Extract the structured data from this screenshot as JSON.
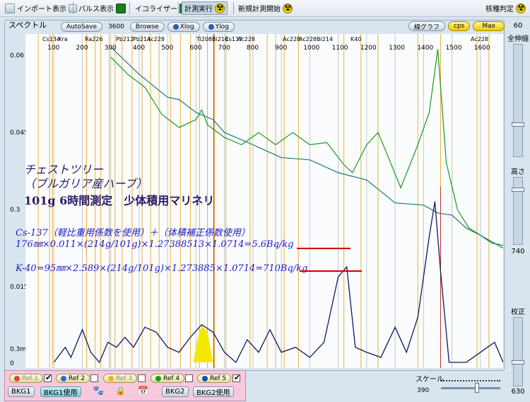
{
  "toolbar": {
    "import_label": "インポート表示",
    "pulse_label": "パルス表示",
    "equalizer_label": "イコライザー",
    "run_label": "計測実行",
    "new_label": "新規計測開始",
    "nuclide_label": "核種判定"
  },
  "spectrum": {
    "panel_title": "スペクトル",
    "autosave_label": "AutoSave",
    "autosave_value": "3600",
    "browse_label": "Browse",
    "xlog_label": "Xlog",
    "ylog_label": "Ylog",
    "line_graph_label": "線グラフ",
    "cps_label": "cps",
    "max_label": "Max"
  },
  "right_panel": {
    "value_top": "60",
    "full_stretch_label": "全伸縮",
    "height_label": "高さ",
    "height_value": "740",
    "correction_label": "校正",
    "correction_value": "630"
  },
  "nuclides": [
    "Cs134",
    "Xra",
    "Ra226",
    "Pb212",
    "Pb214",
    "Ac228",
    "Ti208",
    "Bi214",
    "Cs137",
    "Ac228",
    "Ac228",
    "Ac228",
    "Bi214",
    "K40",
    "Ac228"
  ],
  "annotation": {
    "title_line1": "チェストツリー",
    "title_line2": "（ブルガリア産ハーブ）",
    "title_line3": "101g 6時間測定　少体積用マリネリ",
    "cs_header": "Cs-137（軽比重用係数を使用）＋（体積補正係数使用）",
    "cs_formula": "176㎜×0.011×(214g/101g)×1.27388513×1.0714=5.6Bq/kg",
    "k_formula": "K-40=95㎜×2.589×(214g/101g)×1.273885×1.0714=710Bq/kg"
  },
  "bottom": {
    "refs": [
      {
        "label": "Ref 1",
        "checked": true
      },
      {
        "label": "Ref 2",
        "checked": false
      },
      {
        "label": "Ref 3",
        "checked": false
      },
      {
        "label": "Ref 4",
        "checked": false
      },
      {
        "label": "Ref 5",
        "checked": true
      }
    ],
    "bkg1_label": "BKG1",
    "bkg1_use_label": "BKG1使用",
    "bkg2_label": "BKG2",
    "bkg2_use_label": "BKG2使用",
    "scale_label": "スケール",
    "scale_value": "390"
  },
  "chart_data": {
    "type": "line",
    "x_ticks": [
      "100",
      "200",
      "300",
      "400",
      "500",
      "600",
      "700",
      "800",
      "900",
      "1000",
      "1100",
      "1200",
      "1300",
      "1400",
      "1500",
      "1600"
    ],
    "y_ticks": [
      "0.06",
      "0.045",
      "0.3",
      "0.015",
      "0.3m",
      "0"
    ],
    "xlim": [
      0,
      1680
    ],
    "series": [
      {
        "name": "",
        "color": "#1a9a1a",
        "values": [
          [
            300,
            0.061
          ],
          [
            360,
            0.057
          ],
          [
            420,
            0.055
          ],
          [
            480,
            0.049
          ],
          [
            540,
            0.047
          ],
          [
            600,
            0.048
          ],
          [
            620,
            0.0505
          ],
          [
            640,
            0.047
          ],
          [
            700,
            0.045
          ],
          [
            760,
            0.043
          ],
          [
            820,
            0.046
          ],
          [
            880,
            0.043
          ],
          [
            940,
            0.046
          ],
          [
            1000,
            0.043
          ],
          [
            1060,
            0.044
          ],
          [
            1120,
            0.039
          ],
          [
            1150,
            0.038
          ],
          [
            1200,
            0.043
          ],
          [
            1240,
            0.046
          ],
          [
            1280,
            0.04
          ],
          [
            1320,
            0.035
          ],
          [
            1380,
            0.043
          ],
          [
            1420,
            0.05
          ],
          [
            1450,
            0.062
          ],
          [
            1480,
            0.04
          ],
          [
            1520,
            0.03
          ],
          [
            1560,
            0.027
          ],
          [
            1600,
            0.025
          ],
          [
            1640,
            0.024
          ],
          [
            1680,
            0.023
          ]
        ]
      },
      {
        "name": "",
        "color": "#1a7a7a",
        "values": [
          [
            300,
            0.063
          ],
          [
            400,
            0.057
          ],
          [
            500,
            0.053
          ],
          [
            540,
            0.052
          ],
          [
            600,
            0.05
          ],
          [
            660,
            0.048
          ],
          [
            700,
            0.046
          ],
          [
            800,
            0.043
          ],
          [
            900,
            0.041
          ],
          [
            1000,
            0.04
          ],
          [
            1100,
            0.038
          ],
          [
            1200,
            0.036
          ],
          [
            1300,
            0.032
          ],
          [
            1400,
            0.031
          ],
          [
            1450,
            0.03
          ],
          [
            1500,
            0.029
          ],
          [
            1550,
            0.027
          ],
          [
            1600,
            0.025
          ],
          [
            1680,
            0.023
          ]
        ]
      },
      {
        "name": "",
        "color": "#101860",
        "values": [
          [
            100,
            0.0
          ],
          [
            140,
            0.003
          ],
          [
            160,
            0.001
          ],
          [
            200,
            0.0065
          ],
          [
            230,
            0.002
          ],
          [
            260,
            0.0
          ],
          [
            290,
            0.004
          ],
          [
            320,
            0.003
          ],
          [
            350,
            0.005
          ],
          [
            380,
            0.003
          ],
          [
            420,
            0.007
          ],
          [
            460,
            0.006
          ],
          [
            500,
            0.003
          ],
          [
            540,
            0.002
          ],
          [
            580,
            0.005
          ],
          [
            620,
            0.0075
          ],
          [
            660,
            0.006
          ],
          [
            700,
            0.002
          ],
          [
            740,
            0.0
          ],
          [
            780,
            0.0045
          ],
          [
            820,
            0.002
          ],
          [
            860,
            0.0065
          ],
          [
            900,
            0.002
          ],
          [
            950,
            0.003
          ],
          [
            1000,
            0.001
          ],
          [
            1050,
            0.004
          ],
          [
            1100,
            0.017
          ],
          [
            1130,
            0.019
          ],
          [
            1160,
            0.003
          ],
          [
            1200,
            0.002
          ],
          [
            1250,
            0.001
          ],
          [
            1300,
            0.007
          ],
          [
            1340,
            0.002
          ],
          [
            1380,
            0.009
          ],
          [
            1420,
            0.025
          ],
          [
            1440,
            0.032
          ],
          [
            1460,
            0.018
          ],
          [
            1490,
            0.0
          ],
          [
            1550,
            0.0
          ],
          [
            1600,
            0.002
          ],
          [
            1650,
            0.004
          ],
          [
            1680,
            0.0
          ]
        ]
      }
    ],
    "peak_fill_x": [
      590,
      660
    ]
  }
}
